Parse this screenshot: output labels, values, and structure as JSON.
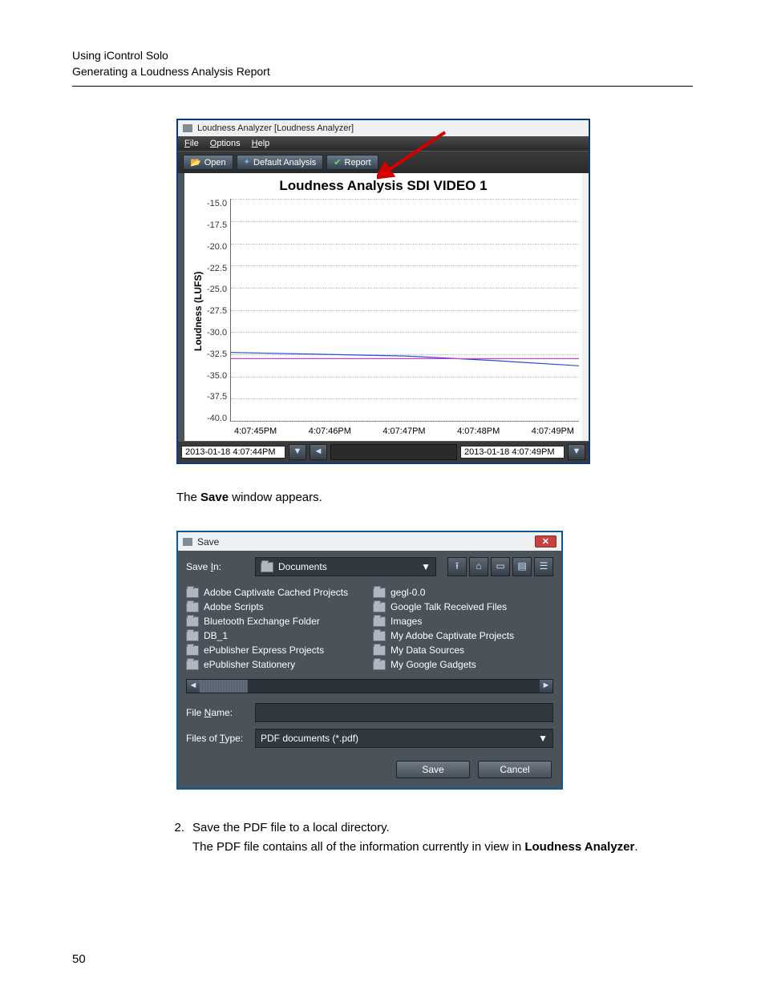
{
  "doc": {
    "header_line1": "Using iControl Solo",
    "header_line2": "Generating a Loudness Analysis Report",
    "page_number": "50",
    "save_appears": "The Save window appears.",
    "step2_num": "2.",
    "step2_line1": "Save the PDF file to a local directory.",
    "step2_line2a": "The PDF file contains all of the information currently in view in ",
    "step2_line2b": "Loudness Analyzer",
    "step2_line2c": ".",
    "save_word": "Save"
  },
  "la": {
    "window_title": "Loudness Analyzer [Loudness Analyzer]",
    "menu": {
      "file": "File",
      "options": "Options",
      "help": "Help"
    },
    "toolbar": {
      "open": "Open",
      "default_analysis": "Default Analysis",
      "report": "Report"
    },
    "chart_title": "Loudness Analysis SDI VIDEO 1",
    "ylabel": "Loudness (LUFS)",
    "footer": {
      "start_time": "2013-01-18 4:07:44PM",
      "end_time": "2013-01-18 4:07:49PM"
    }
  },
  "chart_data": {
    "type": "line",
    "title": "Loudness Analysis SDI VIDEO 1",
    "ylabel": "Loudness (LUFS)",
    "xlabel": "",
    "ylim": [
      -40.0,
      -15.0
    ],
    "y_ticks": [
      "-15.0",
      "-17.5",
      "-20.0",
      "-22.5",
      "-25.0",
      "-27.5",
      "-30.0",
      "-32.5",
      "-35.0",
      "-37.5",
      "-40.0"
    ],
    "x_ticks": [
      "4:07:45PM",
      "4:07:46PM",
      "4:07:47PM",
      "4:07:48PM",
      "4:07:49PM"
    ],
    "series": [
      {
        "name": "Loudness (blue)",
        "color": "#2a4bd7",
        "x": [
          "4:07:45PM",
          "4:07:46PM",
          "4:07:47PM",
          "4:07:48PM",
          "4:07:49PM"
        ],
        "values": [
          -32.3,
          -32.5,
          -32.7,
          -33.2,
          -33.8
        ]
      },
      {
        "name": "Reference (magenta)",
        "color": "#d730d7",
        "x": [
          "4:07:45PM",
          "4:07:46PM",
          "4:07:47PM",
          "4:07:48PM",
          "4:07:49PM"
        ],
        "values": [
          -33.0,
          -33.0,
          -33.0,
          -33.0,
          -33.0
        ]
      }
    ]
  },
  "save": {
    "title": "Save",
    "save_in_label": "Save In:",
    "save_in_value": "Documents",
    "folders_col1": [
      "Adobe Captivate Cached Projects",
      "Adobe Scripts",
      "Bluetooth Exchange Folder",
      "DB_1",
      "ePublisher Express Projects",
      "ePublisher Stationery"
    ],
    "folders_col2": [
      "gegl-0.0",
      "Google Talk Received Files",
      "Images",
      "My Adobe Captivate Projects",
      "My Data Sources",
      "My Google Gadgets"
    ],
    "file_name_label": "File Name:",
    "file_name_value": "",
    "file_type_label": "Files of Type:",
    "file_type_value": "PDF documents (*.pdf)",
    "btn_save": "Save",
    "btn_cancel": "Cancel"
  }
}
